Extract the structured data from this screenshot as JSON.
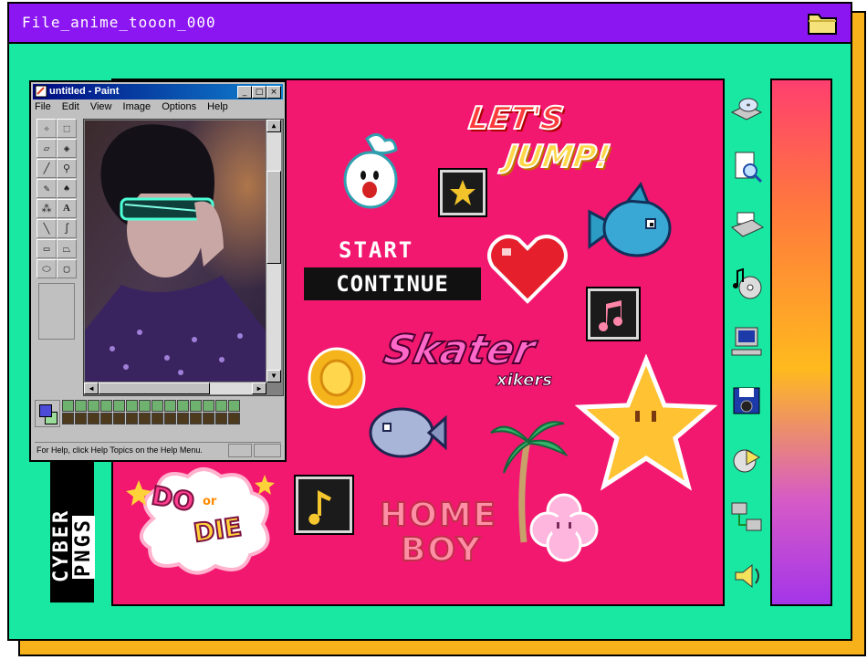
{
  "window": {
    "title": "File_anime_tooon_000",
    "colors": {
      "title_bar": "#8c16f2",
      "body": "#19e8a2",
      "shadow": "#f7b21b",
      "canvas": "#f2186f"
    }
  },
  "paint": {
    "title": "untitled - Paint",
    "controls": {
      "minimize": "_",
      "maximize": "□",
      "close": "×"
    },
    "menu": [
      "File",
      "Edit",
      "View",
      "Image",
      "Options",
      "Help"
    ],
    "tools": [
      "free-select",
      "rect-select",
      "eraser",
      "fill",
      "color-picker",
      "magnifier",
      "pencil",
      "brush",
      "airbrush",
      "text",
      "line",
      "curve",
      "rectangle",
      "polygon",
      "ellipse",
      "rounded-rectangle"
    ],
    "tool_text_glyph": "A",
    "palette_rows": [
      [
        "#6fb26f",
        "#6fb26f",
        "#6fb26f",
        "#6fb26f",
        "#6fb26f",
        "#6fb26f",
        "#6fb26f",
        "#6fb26f",
        "#6fb26f",
        "#6fb26f",
        "#6fb26f",
        "#6fb26f",
        "#6fb26f",
        "#6fb26f"
      ],
      [
        "#4d3a1d",
        "#4d3a1d",
        "#4d3a1d",
        "#4d3a1d",
        "#4d3a1d",
        "#4d3a1d",
        "#4d3a1d",
        "#4d3a1d",
        "#4d3a1d",
        "#4d3a1d",
        "#4d3a1d",
        "#4d3a1d",
        "#4d3a1d",
        "#4d3a1d"
      ]
    ],
    "status": "For Help, click Help Topics on the Help Menu."
  },
  "stickers": {
    "lets": "LET'S",
    "jump": "JUMP!",
    "start": "START",
    "continue": "CONTINUE",
    "skater": "Skater",
    "xikers": "xikers",
    "home": "HOME",
    "boy": "BOY",
    "do": "DO",
    "or": "or",
    "die": "DIE"
  },
  "side_label": {
    "line1": "CYBER",
    "line2": "PNGS"
  },
  "side_icons": [
    "cd-drive-icon",
    "find-file-icon",
    "printer-icon",
    "cd-audio-icon",
    "computer-icon",
    "camera-disk-icon",
    "media-player-icon",
    "network-icon",
    "speaker-icon"
  ]
}
